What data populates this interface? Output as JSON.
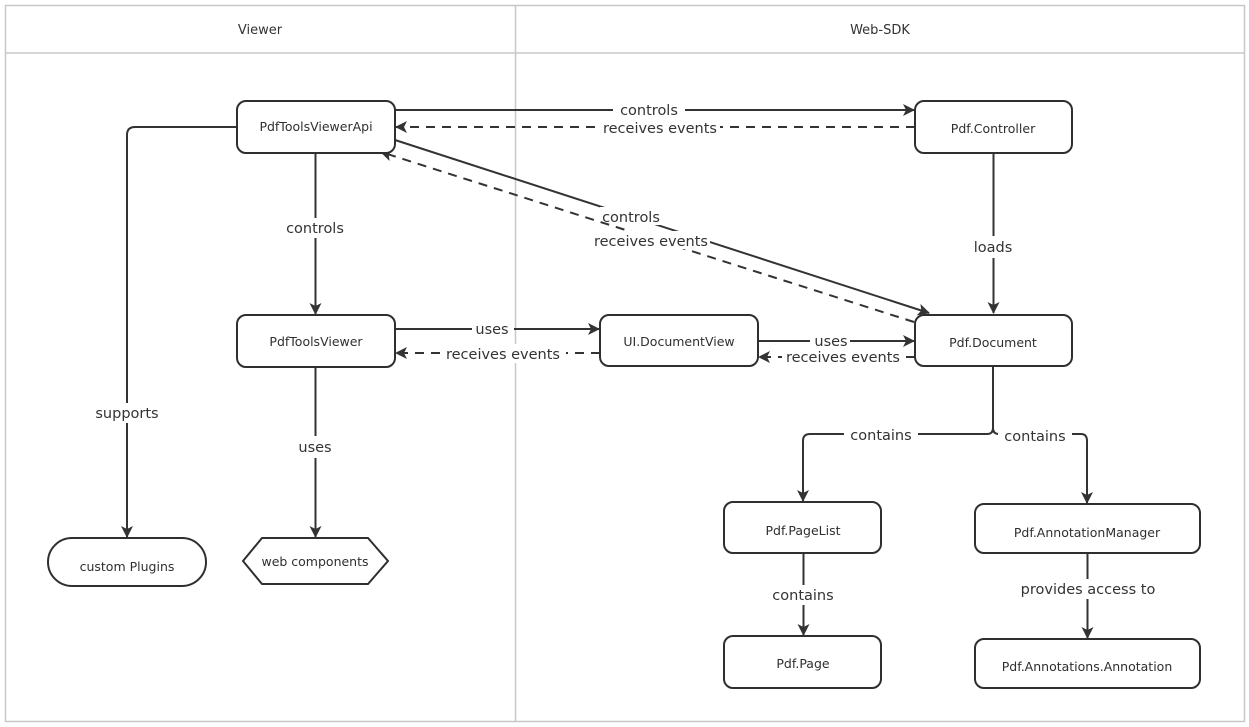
{
  "lanes": [
    {
      "id": "viewer",
      "title": "Viewer"
    },
    {
      "id": "websdk",
      "title": "Web-SDK"
    }
  ],
  "nodes": {
    "api": {
      "label": "PdfToolsViewerApi",
      "lane": "viewer"
    },
    "viewer": {
      "label": "PdfToolsViewer",
      "lane": "viewer"
    },
    "plugins": {
      "label": "custom Plugins",
      "lane": "viewer",
      "shape": "stadium"
    },
    "webcomp": {
      "label": "web components",
      "lane": "viewer",
      "shape": "hexagon"
    },
    "docview": {
      "label": "UI.DocumentView",
      "lane": "websdk"
    },
    "controller": {
      "label": "Pdf.Controller",
      "lane": "websdk"
    },
    "document": {
      "label": "Pdf.Document",
      "lane": "websdk"
    },
    "pagelist": {
      "label": "Pdf.PageList",
      "lane": "websdk"
    },
    "annotmgr": {
      "label": "Pdf.AnnotationManager",
      "lane": "websdk"
    },
    "page": {
      "label": "Pdf.Page",
      "lane": "websdk"
    },
    "annotation": {
      "label": "Pdf.Annotations.Annotation",
      "lane": "websdk"
    }
  },
  "edges": {
    "api_controller": {
      "from": "api",
      "to": "controller",
      "label": "controls",
      "style": "solid"
    },
    "controller_api": {
      "from": "controller",
      "to": "api",
      "label": "receives events",
      "style": "dashed"
    },
    "api_document": {
      "from": "api",
      "to": "document",
      "label": "controls",
      "style": "solid"
    },
    "document_api": {
      "from": "document",
      "to": "api",
      "label": "receives events",
      "style": "dashed"
    },
    "api_viewer": {
      "from": "api",
      "to": "viewer",
      "label": "controls",
      "style": "solid"
    },
    "api_plugins": {
      "from": "api",
      "to": "plugins",
      "label": "supports",
      "style": "solid"
    },
    "viewer_docview": {
      "from": "viewer",
      "to": "docview",
      "label": "uses",
      "style": "solid"
    },
    "docview_viewer": {
      "from": "docview",
      "to": "viewer",
      "label": "receives events",
      "style": "dashed"
    },
    "docview_document": {
      "from": "docview",
      "to": "document",
      "label": "uses",
      "style": "solid"
    },
    "document_docview": {
      "from": "document",
      "to": "docview",
      "label": "receives events",
      "style": "dashed"
    },
    "viewer_webcomp": {
      "from": "viewer",
      "to": "webcomp",
      "label": "uses",
      "style": "solid"
    },
    "controller_document": {
      "from": "controller",
      "to": "document",
      "label": "loads",
      "style": "solid"
    },
    "document_pagelist": {
      "from": "document",
      "to": "pagelist",
      "label": "contains",
      "style": "solid"
    },
    "document_annotmgr": {
      "from": "document",
      "to": "annotmgr",
      "label": "contains",
      "style": "solid"
    },
    "pagelist_page": {
      "from": "pagelist",
      "to": "page",
      "label": "contains",
      "style": "solid"
    },
    "annotmgr_annotation": {
      "from": "annotmgr",
      "to": "annotation",
      "label": "provides access to",
      "style": "solid"
    }
  }
}
